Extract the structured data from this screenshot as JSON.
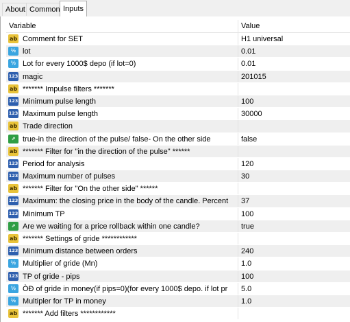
{
  "tabs": [
    {
      "label": "About"
    },
    {
      "label": "Common"
    },
    {
      "label": "Inputs"
    }
  ],
  "table": {
    "header": {
      "variable": "Variable",
      "value": "Value"
    },
    "rows": [
      {
        "icon": "ab",
        "name": "Comment for SET",
        "value": "H1 universal"
      },
      {
        "icon": "v12",
        "name": "lot",
        "value": "0.01"
      },
      {
        "icon": "v12",
        "name": "Lot for every 1000$ depo (if lot=0)",
        "value": "0.01"
      },
      {
        "icon": "n123",
        "name": "magic",
        "value": "201015"
      },
      {
        "icon": "ab",
        "name": "******* Impulse filters *******",
        "value": ""
      },
      {
        "icon": "n123",
        "name": "Minimum pulse length",
        "value": "100"
      },
      {
        "icon": "n123",
        "name": "Maximum pulse length",
        "value": "30000"
      },
      {
        "icon": "ab",
        "name": "Trade direction",
        "value": ""
      },
      {
        "icon": "flag",
        "name": "true-in the direction of the pulse/ false- On the other side",
        "value": "false"
      },
      {
        "icon": "ab",
        "name": "******* Filter for \"in the direction of the pulse\" ******",
        "value": ""
      },
      {
        "icon": "n123",
        "name": "Period for analysis",
        "value": "120"
      },
      {
        "icon": "n123",
        "name": "Maximum number of pulses",
        "value": "30"
      },
      {
        "icon": "ab",
        "name": "******* Filter for \"On the other side\"  ******",
        "value": ""
      },
      {
        "icon": "n123",
        "name": "Maximum: the closing price in the body of the candle. Percent",
        "value": "37"
      },
      {
        "icon": "n123",
        "name": "Minimum TP",
        "value": "100"
      },
      {
        "icon": "flag",
        "name": "Are we waiting for a price rollback within one candle?",
        "value": "true"
      },
      {
        "icon": "ab",
        "name": "******* Settings of gride ************",
        "value": ""
      },
      {
        "icon": "n123",
        "name": "Minimum distance between orders",
        "value": "240"
      },
      {
        "icon": "v12",
        "name": "Multiplier of gride (Mn)",
        "value": "1.0"
      },
      {
        "icon": "n123",
        "name": "TP of gride - pips",
        "value": "100"
      },
      {
        "icon": "v12",
        "name": "ÒÐ of gride in money(if pips=0)(for every 1000$ depo. if lot pr",
        "value": "5.0"
      },
      {
        "icon": "v12",
        "name": "Multipler for TP in money",
        "value": "1.0"
      },
      {
        "icon": "ab",
        "name": "******* Add filters      ************",
        "value": ""
      }
    ]
  },
  "icon_glyphs": {
    "ab": "ab",
    "v12": "½",
    "n123": "123",
    "flag": "⇗"
  }
}
